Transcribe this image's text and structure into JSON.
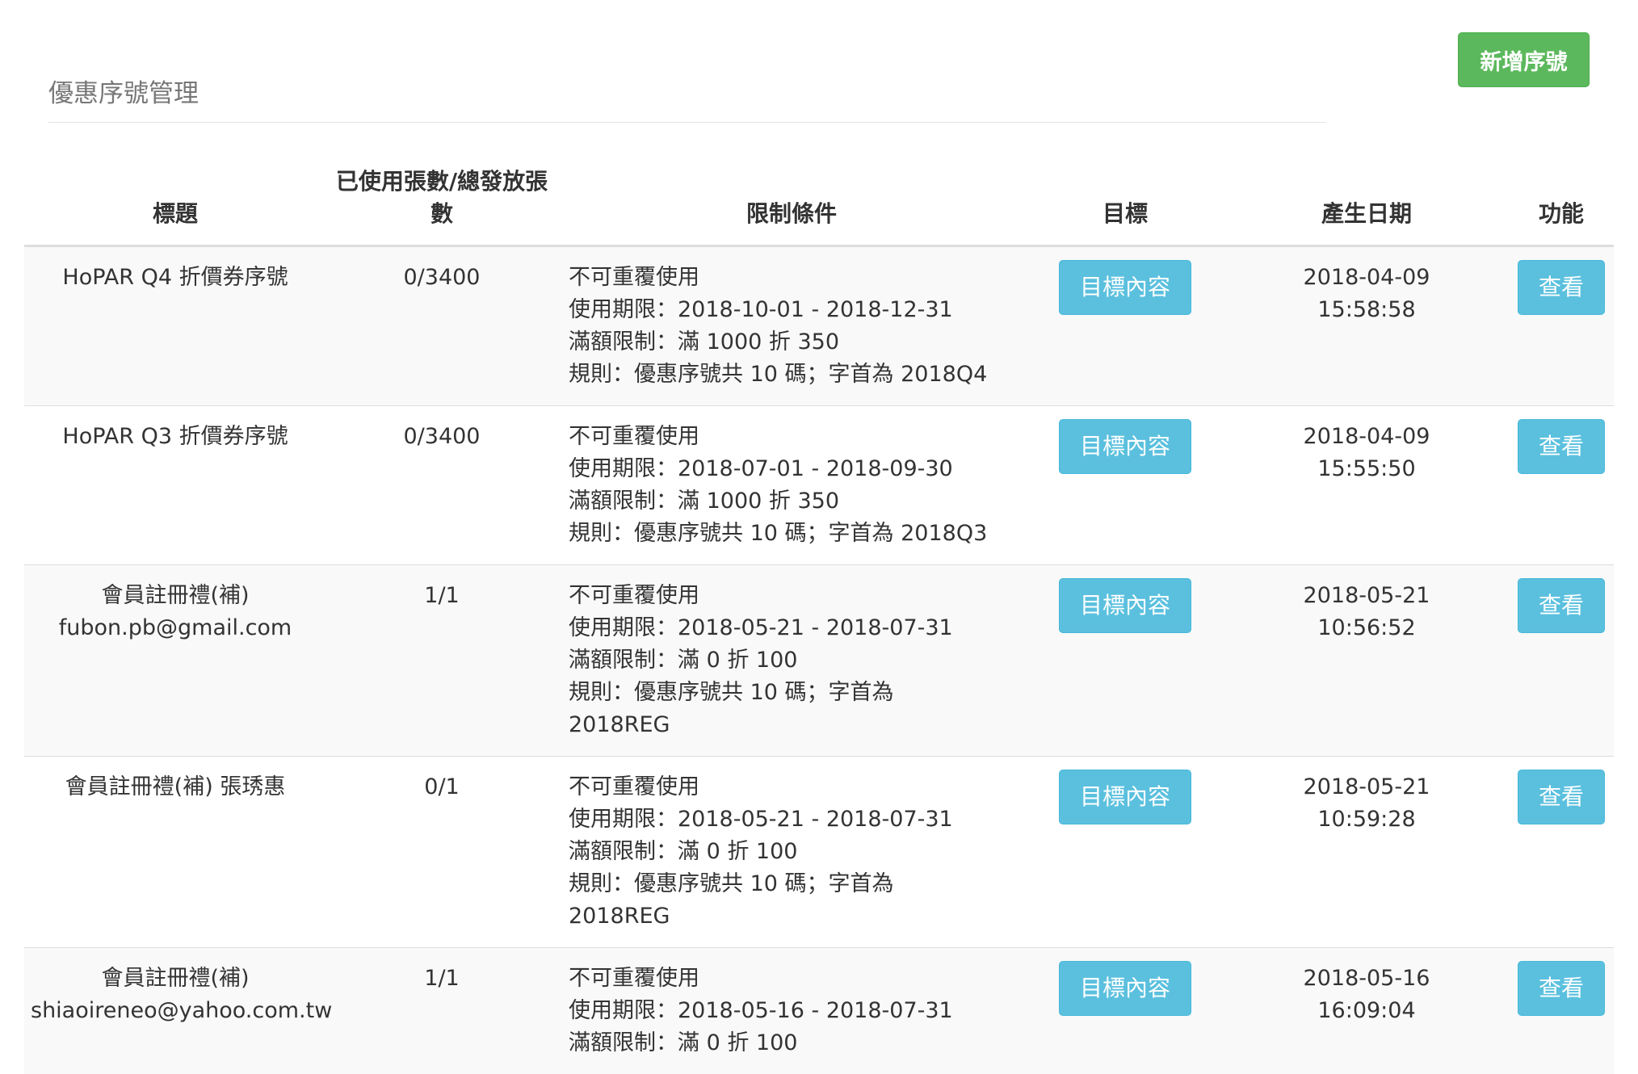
{
  "header": {
    "page_title": "優惠序號管理",
    "add_button": "新增序號"
  },
  "table": {
    "columns": {
      "title": "標題",
      "count": "已使用張數/總發放張數",
      "conditions": "限制條件",
      "target": "目標",
      "date": "產生日期",
      "function": "功能"
    },
    "rows": [
      {
        "title_lines": [
          "HoPAR Q4 折價券序號"
        ],
        "count": "0/3400",
        "conditions": [
          "不可重覆使用",
          "使用期限：2018-10-01 - 2018-12-31",
          "滿額限制：滿 1000 折 350",
          "規則：優惠序號共 10 碼；字首為 2018Q4"
        ],
        "target_button": "目標內容",
        "date": "2018-04-09",
        "time": "15:58:58",
        "view_button": "查看"
      },
      {
        "title_lines": [
          "HoPAR Q3 折價券序號"
        ],
        "count": "0/3400",
        "conditions": [
          "不可重覆使用",
          "使用期限：2018-07-01 - 2018-09-30",
          "滿額限制：滿 1000 折 350",
          "規則：優惠序號共 10 碼；字首為 2018Q3"
        ],
        "target_button": "目標內容",
        "date": "2018-04-09",
        "time": "15:55:50",
        "view_button": "查看"
      },
      {
        "title_lines": [
          "會員註冊禮(補)",
          "fubon.pb@gmail.com"
        ],
        "count": "1/1",
        "conditions": [
          "不可重覆使用",
          "使用期限：2018-05-21 - 2018-07-31",
          "滿額限制：滿 0 折 100",
          "規則：優惠序號共 10 碼；字首為",
          "2018REG"
        ],
        "target_button": "目標內容",
        "date": "2018-05-21",
        "time": "10:56:52",
        "view_button": "查看"
      },
      {
        "title_lines": [
          "會員註冊禮(補) 張琇惠"
        ],
        "count": "0/1",
        "conditions": [
          "不可重覆使用",
          "使用期限：2018-05-21 - 2018-07-31",
          "滿額限制：滿 0 折 100",
          "規則：優惠序號共 10 碼；字首為",
          "2018REG"
        ],
        "target_button": "目標內容",
        "date": "2018-05-21",
        "time": "10:59:28",
        "view_button": "查看"
      },
      {
        "title_lines": [
          "會員註冊禮(補)",
          "shiaoireneo@yahoo.com.tw"
        ],
        "count": "1/1",
        "conditions": [
          "不可重覆使用",
          "使用期限：2018-05-16 - 2018-07-31",
          "滿額限制：滿 0 折 100"
        ],
        "target_button": "目標內容",
        "date": "2018-05-16",
        "time": "16:09:04",
        "view_button": "查看"
      }
    ]
  },
  "colors": {
    "add_button": "#5cb85c",
    "info_button": "#5bc0de",
    "stripe": "#f9f9f9",
    "title_text": "#777777"
  }
}
